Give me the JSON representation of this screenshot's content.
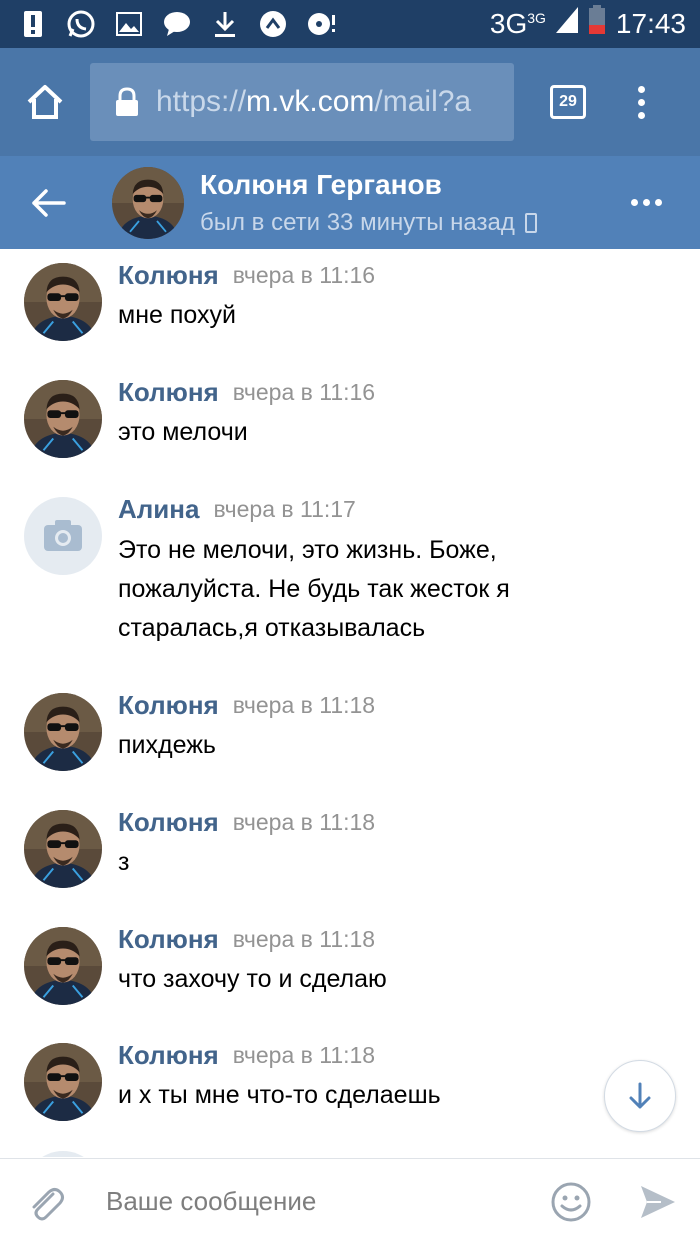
{
  "status_bar": {
    "network": "3G",
    "network_sup": "3G",
    "time": "17:43"
  },
  "browser": {
    "url_scheme": "https://",
    "url_host": "m.vk.com",
    "url_path": "/mail?a",
    "tab_count": "29"
  },
  "chat_header": {
    "name": "Колюня Герганов",
    "status": "был в сети 33 минуты назад"
  },
  "messages": [
    {
      "author": "Колюня",
      "time": "вчера в 11:16",
      "text": "мне похуй",
      "avatar": "user-photo"
    },
    {
      "author": "Колюня",
      "time": "вчера в 11:16",
      "text": "это мелочи",
      "avatar": "user-photo"
    },
    {
      "author": "Алина",
      "time": "вчера в 11:17",
      "text": "Это не мелочи, это жизнь. Боже, пожалуйста. Не будь так жесток я старалась,я отказывалась",
      "avatar": "camera-placeholder"
    },
    {
      "author": "Колюня",
      "time": "вчера в 11:18",
      "text": "пихдежь",
      "avatar": "user-photo"
    },
    {
      "author": "Колюня",
      "time": "вчера в 11:18",
      "text": "з",
      "avatar": "user-photo"
    },
    {
      "author": "Колюня",
      "time": "вчера в 11:18",
      "text": "что захочу то и сделаю",
      "avatar": "user-photo"
    },
    {
      "author": "Колюня",
      "time": "вчера в 11:18",
      "text": "и х ты мне что-то сделаешь",
      "avatar": "user-photo"
    }
  ],
  "composer": {
    "placeholder": "Ваше сообщение"
  },
  "colors": {
    "status_bar": "#1f3f66",
    "browser_bar": "#4a76a8",
    "chat_header": "#5181b8",
    "author_name": "#42648b"
  }
}
